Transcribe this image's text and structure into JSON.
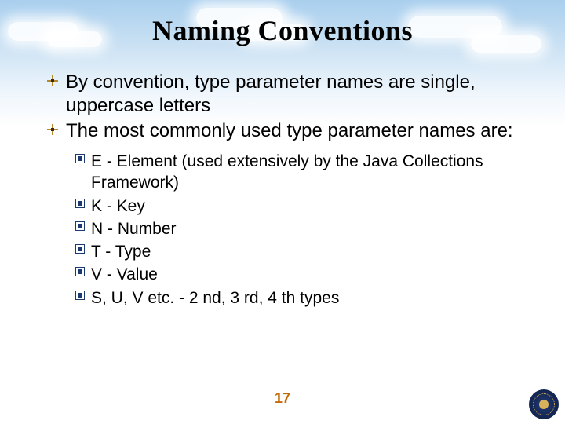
{
  "title": "Naming Conventions",
  "bullets": [
    "By convention, type parameter names are single, uppercase letters",
    "The most commonly used type parameter names are:"
  ],
  "subBullets": [
    "E - Element (used extensively by the Java Collections Framework)",
    "K - Key",
    "N - Number",
    "T - Type",
    "V - Value",
    "S, U, V etc. - 2 nd, 3 rd, 4 th types"
  ],
  "pageNumber": "17"
}
